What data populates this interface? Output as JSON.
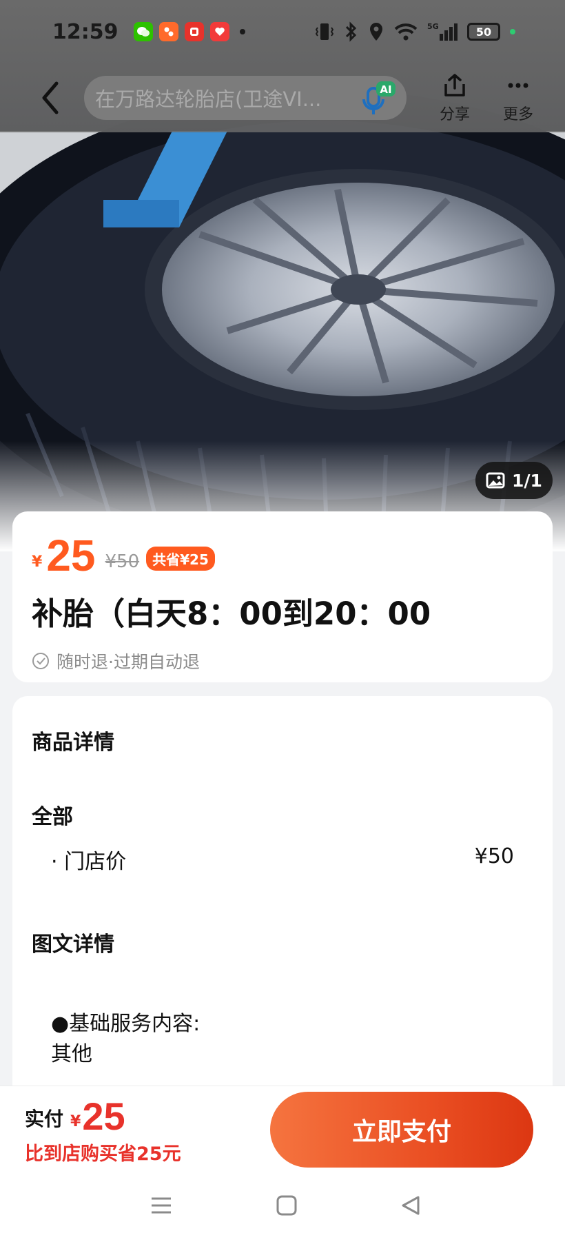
{
  "status_bar": {
    "time": "12:59",
    "apps": [
      {
        "name": "wechat-app-icon",
        "color": "#2dc100",
        "glyph": ""
      },
      {
        "name": "pinduoduo-app-icon",
        "color": "#ff6a2b",
        "glyph": ""
      },
      {
        "name": "taobao-app-icon",
        "color": "#e8322b",
        "glyph": ""
      },
      {
        "name": "dianping-app-icon",
        "color": "#f23a3a",
        "glyph": ""
      }
    ],
    "battery": "50"
  },
  "nav": {
    "search_text": "在万路达轮胎店(卫途VI...",
    "ai_badge": "AI",
    "share_label": "分享",
    "more_label": "更多"
  },
  "gallery": {
    "counter": "1/1"
  },
  "product": {
    "currency": "¥",
    "price": "25",
    "original_price": "¥50",
    "save_badge": "共省¥25",
    "title": "补胎（白天8：00到20：00",
    "refund_policy": "随时退·过期自动退"
  },
  "details": {
    "section_title": "商品详情",
    "group_title": "全部",
    "items": [
      {
        "name": "· 门店价",
        "price": "¥50"
      }
    ],
    "rich_title": "图文详情",
    "rich_lines": [
      "●基础服务内容:",
      "其他"
    ]
  },
  "pay_bar": {
    "label": "实付",
    "currency": "¥",
    "amount": "25",
    "save_note": "比到店购买省25元",
    "button_label": "立即支付"
  },
  "colors": {
    "accent": "#ff5a1f",
    "pay_red": "#e8322b"
  }
}
